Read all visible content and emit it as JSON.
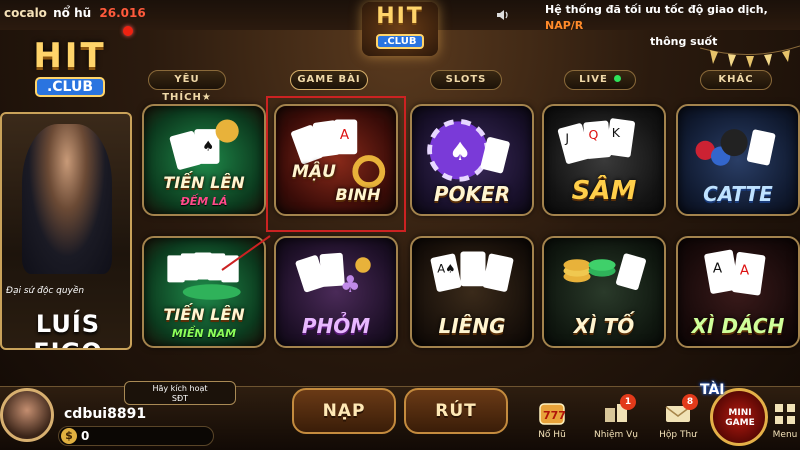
{
  "header": {
    "jackpot_user": "cocalo",
    "jackpot_label": "nổ hũ",
    "jackpot_amount": "26.016",
    "ticker_text": "Hệ thống đã tối ưu tốc độ giao dịch,",
    "ticker_highlight": "NAP/R",
    "ticker_text2": "thông suốt",
    "logo_hit": "HIT",
    "logo_club": ".CLUB"
  },
  "tabs": [
    {
      "label": "YÊU THÍCH★"
    },
    {
      "label": "GAME BÀI"
    },
    {
      "label": "SLOTS"
    },
    {
      "label": "LIVE"
    },
    {
      "label": "KHÁC"
    }
  ],
  "promo": {
    "tagline": "Đại sứ độc quyền",
    "name": "LUÍS FIGO"
  },
  "games": [
    {
      "label": "TIẾN LÊN",
      "sub": "ĐẾM LÁ"
    },
    {
      "label": "MẬU",
      "sub": "BINH"
    },
    {
      "label": "POKER",
      "sub": ""
    },
    {
      "label": "SÂM",
      "sub": ""
    },
    {
      "label": "CATTE",
      "sub": ""
    },
    {
      "label": "TIẾN LÊN",
      "sub": "MIỀN NAM"
    },
    {
      "label": "PHỎM",
      "sub": ""
    },
    {
      "label": "LIÊNG",
      "sub": ""
    },
    {
      "label": "XÌ TỐ",
      "sub": ""
    },
    {
      "label": "XÌ DÁCH",
      "sub": ""
    }
  ],
  "user": {
    "activate_line1": "Hãy kích hoạt",
    "activate_line2": "SĐT",
    "username": "cdbui8891",
    "balance": "0",
    "currency_symbol": "$"
  },
  "actions": {
    "deposit": "NẠP",
    "withdraw": "RÚT"
  },
  "menu": [
    {
      "label": "Nổ Hũ",
      "badge": ""
    },
    {
      "label": "Nhiệm Vụ",
      "badge": "1"
    },
    {
      "label": "Hộp Thư",
      "badge": "8"
    },
    {
      "label": "Menu",
      "badge": ""
    }
  ],
  "mini_game": {
    "top": "TÀI",
    "line1": "MINI",
    "line2": "GAME"
  },
  "colors": {
    "gold": "#ffd46a",
    "accent_red": "#ff5a3c",
    "highlight_orange": "#ff8a2a",
    "club_blue": "#2a74e0"
  }
}
